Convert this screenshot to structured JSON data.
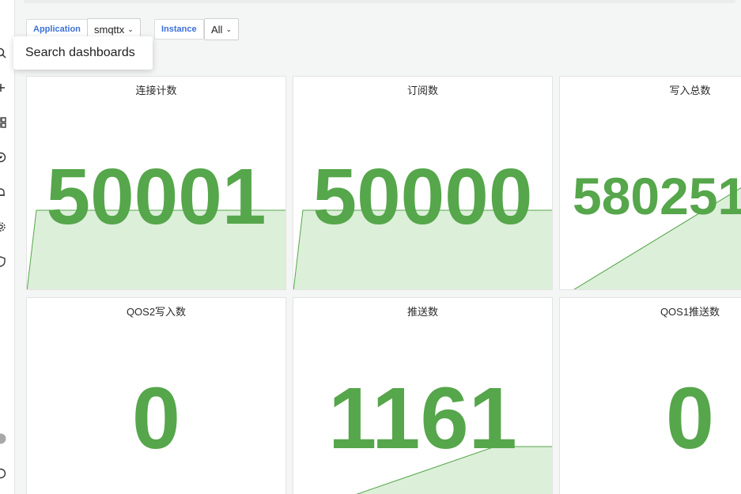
{
  "variables": {
    "application": {
      "label": "Application",
      "value": "smqttx"
    },
    "instance": {
      "label": "Instance",
      "value": "All"
    }
  },
  "tooltip": {
    "text": "Search dashboards"
  },
  "sidebar": {
    "icons": [
      "search-icon",
      "plus-icon",
      "dashboards-icon",
      "explore-icon",
      "alerting-icon",
      "settings-icon",
      "shield-icon",
      "avatar-icon",
      "help-icon"
    ]
  },
  "panels": [
    {
      "title": "连接计数",
      "value": "50001"
    },
    {
      "title": "订阅数",
      "value": "50000"
    },
    {
      "title": "写入总数",
      "value": "580251"
    },
    {
      "title": "QOS2写入数",
      "value": "0"
    },
    {
      "title": "推送数",
      "value": "1161"
    },
    {
      "title": "QOS1推送数",
      "value": "0"
    }
  ],
  "colors": {
    "value": "#56a64b",
    "sparkline_fill": "#dcefd9",
    "sparkline_line": "#56a64b",
    "variable_label": "#3d71d9"
  }
}
